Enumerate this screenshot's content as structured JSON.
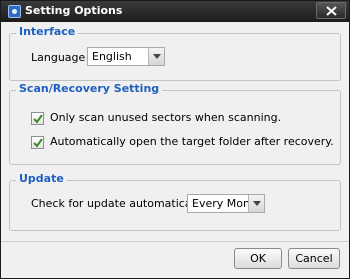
{
  "window": {
    "title": "Setting Options"
  },
  "interface": {
    "title": "Interface",
    "language_label": "Language",
    "language_value": "English"
  },
  "scan": {
    "title": "Scan/Recovery Setting",
    "options": [
      {
        "label": "Only scan unused sectors when scanning.",
        "checked": true
      },
      {
        "label": "Automatically open the target folder after recovery.",
        "checked": true
      }
    ]
  },
  "update": {
    "title": "Update",
    "check_label": "Check for update automatically",
    "frequency_value": "Every Month"
  },
  "buttons": {
    "ok": "OK",
    "cancel": "Cancel"
  },
  "colors": {
    "accent": "#1f5fbf",
    "titlebar": "#1c1c1c",
    "check": "#3a8a2a"
  },
  "icons": [
    "app-icon",
    "close-icon",
    "chevron-down-icon",
    "checkmark-icon"
  ]
}
